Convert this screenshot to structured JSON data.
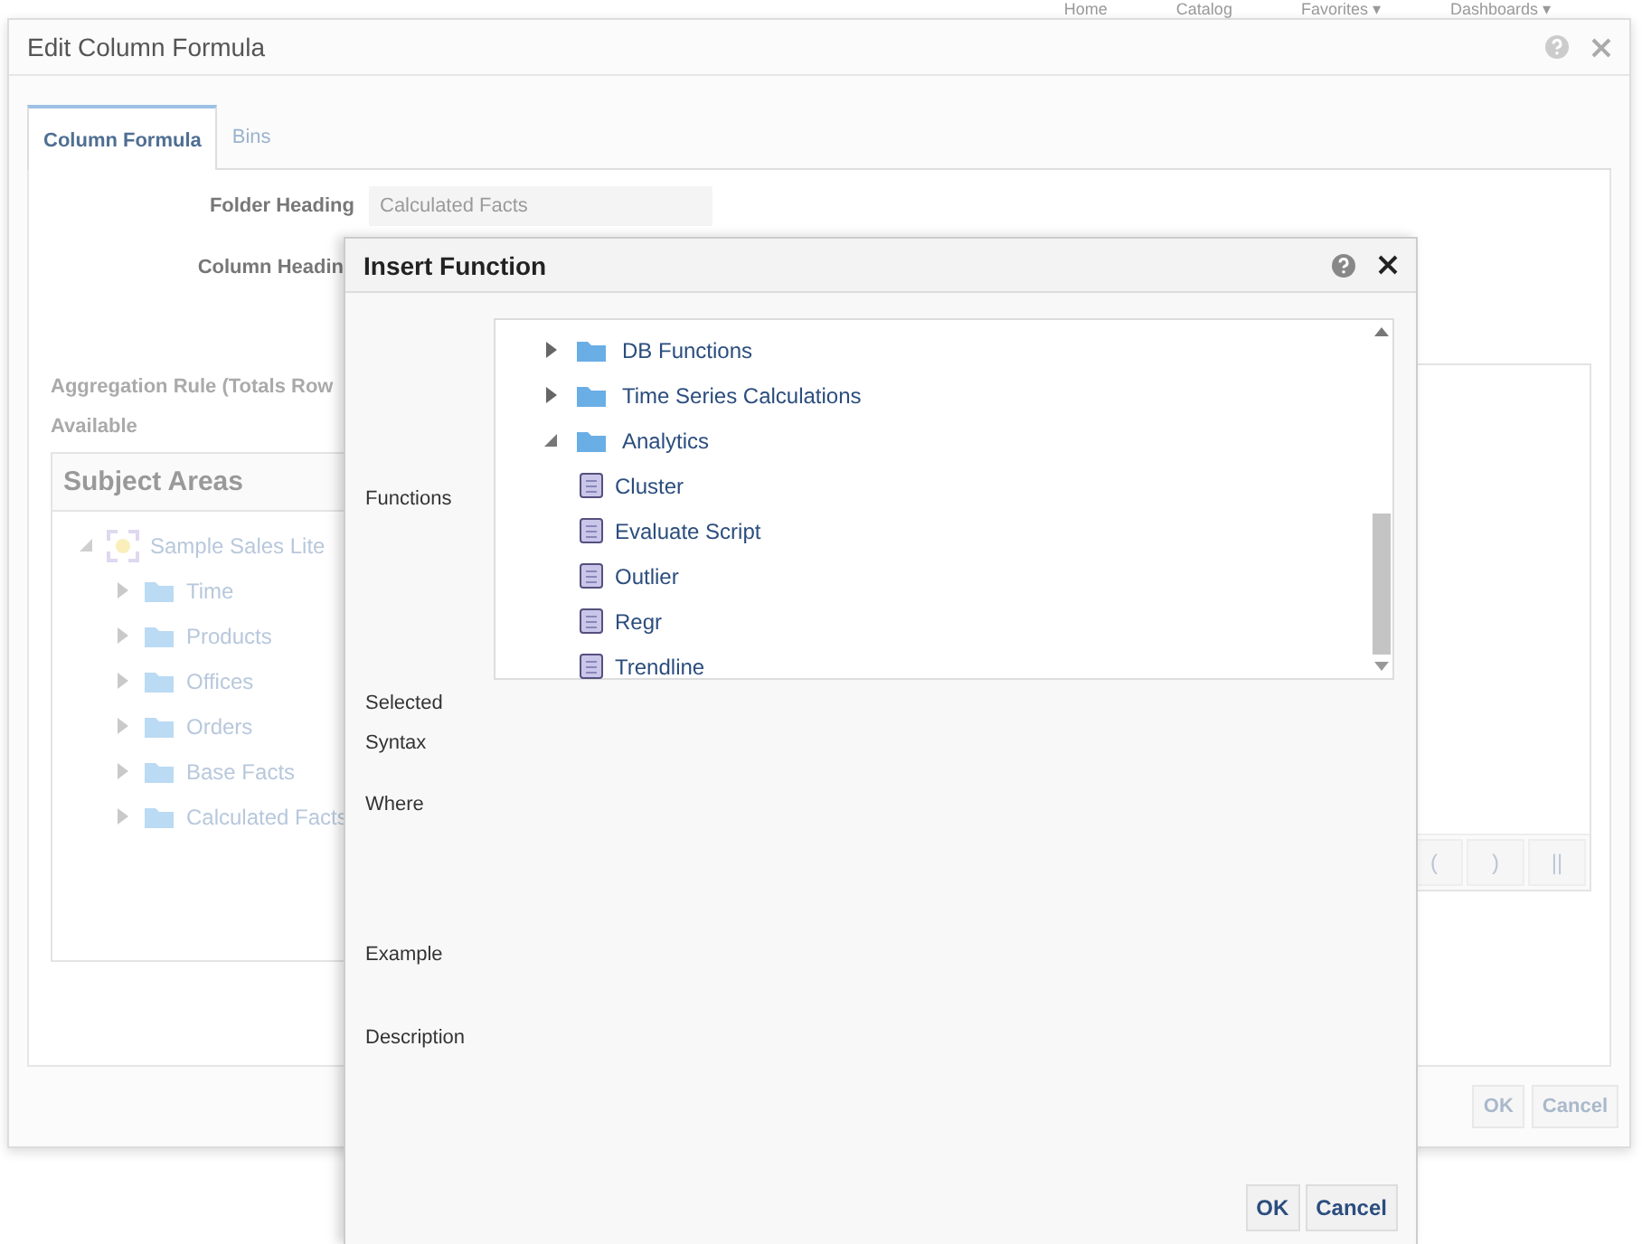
{
  "top_nav": [
    "Home",
    "Catalog",
    "Favorites ▾",
    "Dashboards ▾"
  ],
  "edit_dialog": {
    "title": "Edit Column Formula",
    "tabs": [
      {
        "label": "Column Formula",
        "selected": true
      },
      {
        "label": "Bins",
        "selected": false
      }
    ],
    "folder_heading": {
      "label": "Folder Heading",
      "value": "Calculated Facts"
    },
    "column_heading": {
      "label": "Column Headin"
    },
    "aggregation_label": "Aggregation Rule (Totals Row",
    "available_label": "Available",
    "subject_areas": {
      "title": "Subject Areas",
      "tree": [
        {
          "label": "Sample Sales Lite",
          "expanded": true,
          "children": [
            {
              "label": "Time",
              "expanded": false
            },
            {
              "label": "Products",
              "expanded": false
            },
            {
              "label": "Offices",
              "expanded": false
            },
            {
              "label": "Orders",
              "expanded": false
            },
            {
              "label": "Base Facts",
              "expanded": false
            },
            {
              "label": "Calculated Facts",
              "expanded": false
            }
          ]
        }
      ]
    },
    "operator_buttons": [
      "(",
      ")",
      "||"
    ],
    "buttons": [
      "OK",
      "Cancel"
    ]
  },
  "insert_function": {
    "title": "Insert Function",
    "functions_label": "Functions",
    "tree": [
      {
        "label": "DB Functions",
        "expanded": false
      },
      {
        "label": "Time Series Calculations",
        "expanded": false
      },
      {
        "label": "Analytics",
        "expanded": true,
        "children": [
          {
            "label": "Cluster"
          },
          {
            "label": "Evaluate Script"
          },
          {
            "label": "Outlier"
          },
          {
            "label": "Regr"
          },
          {
            "label": "Trendline"
          }
        ]
      }
    ],
    "field_labels": [
      "Selected Syntax",
      "Where",
      "Example",
      "Description"
    ],
    "buttons": [
      "OK",
      "Cancel"
    ]
  }
}
